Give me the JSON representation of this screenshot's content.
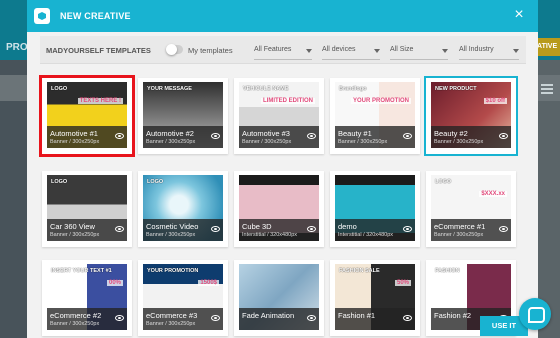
{
  "background": {
    "project_label": "PROJ",
    "right_button": "CATIVE"
  },
  "modal": {
    "title": "NEW CREATIVE",
    "close_icon": "close-icon"
  },
  "filters": {
    "templates_title": "MADYOURSELF TEMPLATES",
    "my_templates_label": "My templates",
    "features": "All Features",
    "devices": "All devices",
    "size": "All Size",
    "industry": "All Industry"
  },
  "cards": [
    {
      "name": "Automotive #1",
      "size": "Banner / 300x250px",
      "thumb": "thumb-car-logo",
      "title": "LOGO",
      "text": "TEXTS HERE !",
      "selected": "red"
    },
    {
      "name": "Automotive #2",
      "size": "Banner / 300x250px",
      "thumb": "thumb-car-message",
      "title": "YOUR MESSAGE",
      "text": ""
    },
    {
      "name": "Automotive #3",
      "size": "Banner / 300x250px",
      "thumb": "thumb-car-vehicle",
      "title": "VEHICULE NAME",
      "text": "LIMITED EDITION"
    },
    {
      "name": "Beauty #1",
      "size": "Banner / 300x250px",
      "thumb": "thumb-beauty-promo",
      "title": "Brandlogo",
      "text": "YOUR PROMOTION"
    },
    {
      "name": "Beauty #2",
      "size": "Banner / 300x250px",
      "thumb": "thumb-beauty-product",
      "title": "NEW PRODUCT",
      "text": "$10 off",
      "selected": "blue"
    },
    {
      "name": "Car 360 View",
      "size": "Banner / 300x250px",
      "thumb": "thumb-car-360",
      "title": "LOGO",
      "text": ""
    },
    {
      "name": "Cosmetic Video",
      "size": "Banner / 300x250px",
      "thumb": "thumb-cosmetic",
      "title": "LOGO",
      "text": ""
    },
    {
      "name": "Cube 3D",
      "size": "Interstitial / 320x480px",
      "thumb": "thumb-phone-pink",
      "title": "",
      "text": ""
    },
    {
      "name": "demo",
      "size": "Interstitial / 320x480px",
      "thumb": "thumb-phone-blue",
      "title": "",
      "text": ""
    },
    {
      "name": "eCommerce #1",
      "size": "Banner / 300x250px",
      "thumb": "thumb-laptop",
      "title": "LOGO",
      "text": "$XXX.xx"
    },
    {
      "name": "eCommerce #2",
      "size": "Banner / 300x250px",
      "thumb": "thumb-shoe",
      "title": "INSERT YOUR TEXT #1",
      "text": "00%"
    },
    {
      "name": "eCommerce #3",
      "size": "Banner / 300x250px",
      "thumb": "thumb-camera",
      "title": "YOUR PROMOTION",
      "text": "1500$"
    },
    {
      "name": "Fade Animation",
      "size": "",
      "thumb": "thumb-fade",
      "title": "",
      "text": ""
    },
    {
      "name": "Fashion #1",
      "size": "",
      "thumb": "thumb-fashion-sale",
      "title": "FASHION SALE",
      "text": "50%"
    },
    {
      "name": "Fashion #2",
      "size": "",
      "thumb": "thumb-fashion-2",
      "title": "FASHION",
      "text": ""
    }
  ],
  "footer": {
    "use_it": "USE IT",
    "chat_icon": "chat-icon"
  },
  "colors": {
    "accent": "#18b3d1",
    "selected_red": "#e8141c"
  }
}
